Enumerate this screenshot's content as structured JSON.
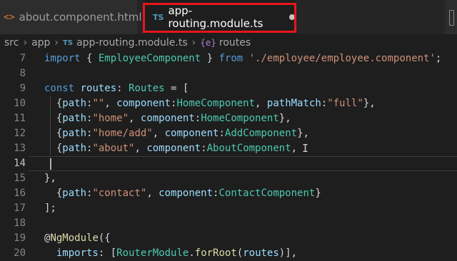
{
  "tabs": [
    {
      "icon": "<>",
      "label": "about.component.html"
    },
    {
      "icon": "TS",
      "label": "app-routing.module.ts"
    }
  ],
  "breadcrumb": {
    "items": [
      "src",
      "app",
      "app-routing.module.ts",
      "routes"
    ],
    "file_icon": "TS",
    "symbol_icon": "{e}"
  },
  "editor": {
    "line_numbers": [
      "7",
      "8",
      "9",
      "10",
      "11",
      "12",
      "13",
      "14",
      "15",
      "16",
      "17",
      "18",
      "19",
      "20"
    ],
    "active_line": "14",
    "lines": [
      [
        [
          "k",
          "import"
        ],
        [
          "p",
          " { "
        ],
        [
          "t",
          "EmployeeComponent"
        ],
        [
          "p",
          " } "
        ],
        [
          "k",
          "from"
        ],
        [
          "p",
          " "
        ],
        [
          "s",
          "'./employee/employee.component'"
        ],
        [
          "p",
          ";"
        ]
      ],
      [],
      [
        [
          "k",
          "const"
        ],
        [
          "p",
          " "
        ],
        [
          "v",
          "routes"
        ],
        [
          "p",
          ": "
        ],
        [
          "t",
          "Routes"
        ],
        [
          "p",
          " = ["
        ]
      ],
      [
        [
          "p",
          "  {"
        ],
        [
          "v",
          "path"
        ],
        [
          "p",
          ":"
        ],
        [
          "s",
          "\"\""
        ],
        [
          "p",
          ", "
        ],
        [
          "v",
          "component"
        ],
        [
          "p",
          ":"
        ],
        [
          "t",
          "HomeComponent"
        ],
        [
          "p",
          ", "
        ],
        [
          "v",
          "pathMatch"
        ],
        [
          "p",
          ":"
        ],
        [
          "s",
          "\"full\""
        ],
        [
          "p",
          "},"
        ]
      ],
      [
        [
          "p",
          "  {"
        ],
        [
          "v",
          "path"
        ],
        [
          "p",
          ":"
        ],
        [
          "s",
          "\"home\""
        ],
        [
          "p",
          ", "
        ],
        [
          "v",
          "component"
        ],
        [
          "p",
          ":"
        ],
        [
          "t",
          "HomeComponent"
        ],
        [
          "p",
          "},"
        ]
      ],
      [
        [
          "p",
          "  {"
        ],
        [
          "v",
          "path"
        ],
        [
          "p",
          ":"
        ],
        [
          "s",
          "\"home/add\""
        ],
        [
          "p",
          ", "
        ],
        [
          "v",
          "component"
        ],
        [
          "p",
          ":"
        ],
        [
          "t",
          "AddComponent"
        ],
        [
          "p",
          "},"
        ]
      ],
      [
        [
          "p",
          "  {"
        ],
        [
          "v",
          "path"
        ],
        [
          "p",
          ":"
        ],
        [
          "s",
          "\"about\""
        ],
        [
          "p",
          ", "
        ],
        [
          "v",
          "component"
        ],
        [
          "p",
          ":"
        ],
        [
          "t",
          "AboutComponent"
        ],
        [
          "p",
          ","
        ]
      ],
      [],
      [
        [
          "p",
          "},"
        ]
      ],
      [
        [
          "p",
          "  {"
        ],
        [
          "v",
          "path"
        ],
        [
          "p",
          ":"
        ],
        [
          "s",
          "\"contact\""
        ],
        [
          "p",
          ", "
        ],
        [
          "v",
          "component"
        ],
        [
          "p",
          ":"
        ],
        [
          "t",
          "ContactComponent"
        ],
        [
          "p",
          "}"
        ]
      ],
      [
        [
          "p",
          "];"
        ]
      ],
      [],
      [
        [
          "p",
          "@"
        ],
        [
          "f",
          "NgModule"
        ],
        [
          "p",
          "({"
        ]
      ],
      [
        [
          "p",
          "  "
        ],
        [
          "v",
          "imports"
        ],
        [
          "p",
          ": ["
        ],
        [
          "t",
          "RouterModule"
        ],
        [
          "p",
          "."
        ],
        [
          "f",
          "forRoot"
        ],
        [
          "p",
          "("
        ],
        [
          "v",
          "routes"
        ],
        [
          "p",
          ")],"
        ]
      ]
    ]
  },
  "colors": {
    "tab_highlight": "#e8151c",
    "editor_bg": "#1e1e1e",
    "keyword": "#569cd6",
    "type": "#4ec9b0",
    "string": "#ce9178"
  }
}
